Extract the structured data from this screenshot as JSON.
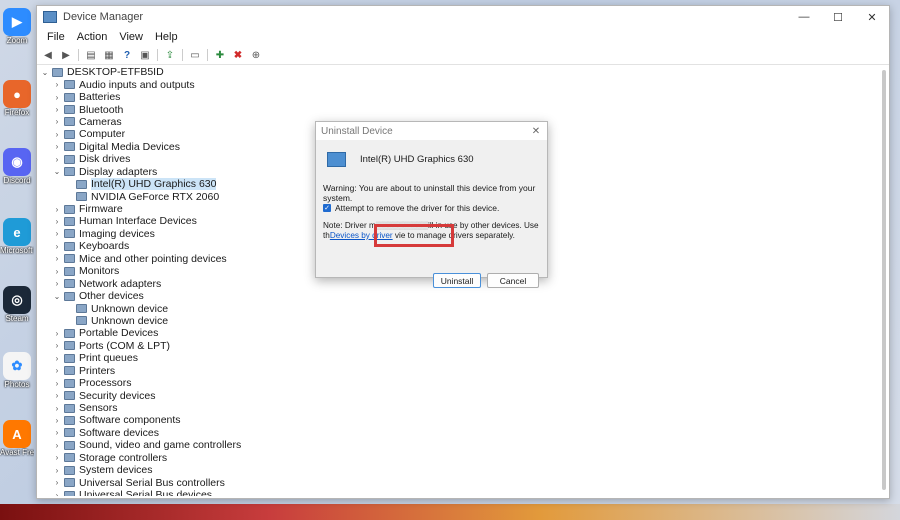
{
  "desktop": {
    "icons": [
      {
        "label": "Zoom",
        "color": "#2d8cff",
        "icon": "zoom-icon",
        "glyph": "▶"
      },
      {
        "label": "Firefox",
        "color": "#e8662a",
        "icon": "firefox-icon",
        "glyph": "●"
      },
      {
        "label": "Discord",
        "color": "#5865f2",
        "icon": "discord-icon",
        "glyph": "◉"
      },
      {
        "label": "Microsoft Edge",
        "color": "#1f9bd7",
        "icon": "edge-icon",
        "glyph": "e"
      },
      {
        "label": "Steam",
        "color": "#1b2838",
        "icon": "steam-icon",
        "glyph": "◎"
      },
      {
        "label": "Photos",
        "color": "#f5f5f5",
        "icon": "photos-icon",
        "glyph": "✿"
      },
      {
        "label": "Avast Free Antivirus",
        "color": "#ff7800",
        "icon": "avast-icon",
        "glyph": "A"
      }
    ]
  },
  "window": {
    "title": "Device Manager",
    "controls": {
      "minimize": "—",
      "maximize": "☐",
      "close": "✕"
    },
    "menu": [
      "File",
      "Action",
      "View",
      "Help"
    ]
  },
  "tree": [
    {
      "label": "DESKTOP-ETFB5ID",
      "level": 0,
      "expander": "⌄"
    },
    {
      "label": "Audio inputs and outputs",
      "level": 1,
      "expander": "›"
    },
    {
      "label": "Batteries",
      "level": 1,
      "expander": "›"
    },
    {
      "label": "Bluetooth",
      "level": 1,
      "expander": "›"
    },
    {
      "label": "Cameras",
      "level": 1,
      "expander": "›"
    },
    {
      "label": "Computer",
      "level": 1,
      "expander": "›"
    },
    {
      "label": "Digital Media Devices",
      "level": 1,
      "expander": "›"
    },
    {
      "label": "Disk drives",
      "level": 1,
      "expander": "›"
    },
    {
      "label": "Display adapters",
      "level": 1,
      "expander": "⌄"
    },
    {
      "label": "Intel(R) UHD Graphics 630",
      "level": 2,
      "expander": "",
      "selected": true
    },
    {
      "label": "NVIDIA GeForce RTX 2060",
      "level": 2,
      "expander": ""
    },
    {
      "label": "Firmware",
      "level": 1,
      "expander": "›"
    },
    {
      "label": "Human Interface Devices",
      "level": 1,
      "expander": "›"
    },
    {
      "label": "Imaging devices",
      "level": 1,
      "expander": "›"
    },
    {
      "label": "Keyboards",
      "level": 1,
      "expander": "›"
    },
    {
      "label": "Mice and other pointing devices",
      "level": 1,
      "expander": "›"
    },
    {
      "label": "Monitors",
      "level": 1,
      "expander": "›"
    },
    {
      "label": "Network adapters",
      "level": 1,
      "expander": "›"
    },
    {
      "label": "Other devices",
      "level": 1,
      "expander": "⌄"
    },
    {
      "label": "Unknown device",
      "level": 2,
      "expander": ""
    },
    {
      "label": "Unknown device",
      "level": 2,
      "expander": ""
    },
    {
      "label": "Portable Devices",
      "level": 1,
      "expander": "›"
    },
    {
      "label": "Ports (COM & LPT)",
      "level": 1,
      "expander": "›"
    },
    {
      "label": "Print queues",
      "level": 1,
      "expander": "›"
    },
    {
      "label": "Printers",
      "level": 1,
      "expander": "›"
    },
    {
      "label": "Processors",
      "level": 1,
      "expander": "›"
    },
    {
      "label": "Security devices",
      "level": 1,
      "expander": "›"
    },
    {
      "label": "Sensors",
      "level": 1,
      "expander": "›"
    },
    {
      "label": "Software components",
      "level": 1,
      "expander": "›"
    },
    {
      "label": "Software devices",
      "level": 1,
      "expander": "›"
    },
    {
      "label": "Sound, video and game controllers",
      "level": 1,
      "expander": "›"
    },
    {
      "label": "Storage controllers",
      "level": 1,
      "expander": "›"
    },
    {
      "label": "System devices",
      "level": 1,
      "expander": "›"
    },
    {
      "label": "Universal Serial Bus controllers",
      "level": 1,
      "expander": "›"
    },
    {
      "label": "Universal Serial Bus devices",
      "level": 1,
      "expander": "›"
    }
  ],
  "dialog": {
    "title": "Uninstall Device",
    "close": "✕",
    "device_name": "Intel(R) UHD Graphics 630",
    "warning": "Warning: You are about to uninstall this device from your system.",
    "checkbox_label": "Attempt to remove the driver for this device.",
    "checkbox_checked": true,
    "note_start": "Note: Driver m",
    "note_mid": "ill in use by other devices. Use th",
    "note_link": "Devices by driver",
    "note_end": "vie to manage drivers separately.",
    "uninstall_label": "Uninstall",
    "cancel_label": "Cancel"
  },
  "colors": {
    "highlight": "#d63a3a",
    "selection": "#cce4f7",
    "link": "#0a55c8"
  }
}
